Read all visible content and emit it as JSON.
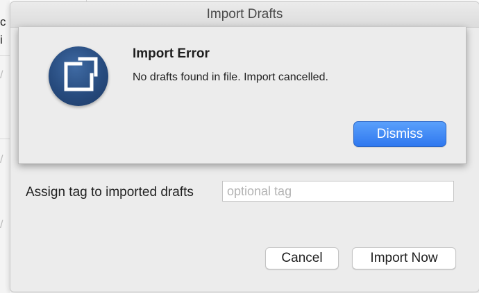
{
  "background": {
    "fragments": [
      "c",
      "i",
      "/",
      "/",
      "/"
    ]
  },
  "window": {
    "title": "Import Drafts"
  },
  "alert": {
    "icon": "drafts-app-icon",
    "title": "Import Error",
    "message": "No drafts found in file. Import cancelled.",
    "dismiss_label": "Dismiss",
    "accent_color": "#3b82f6"
  },
  "form": {
    "tag_label": "Assign tag to imported drafts",
    "tag_value": "",
    "tag_placeholder": "optional tag"
  },
  "actions": {
    "cancel_label": "Cancel",
    "import_label": "Import Now"
  }
}
